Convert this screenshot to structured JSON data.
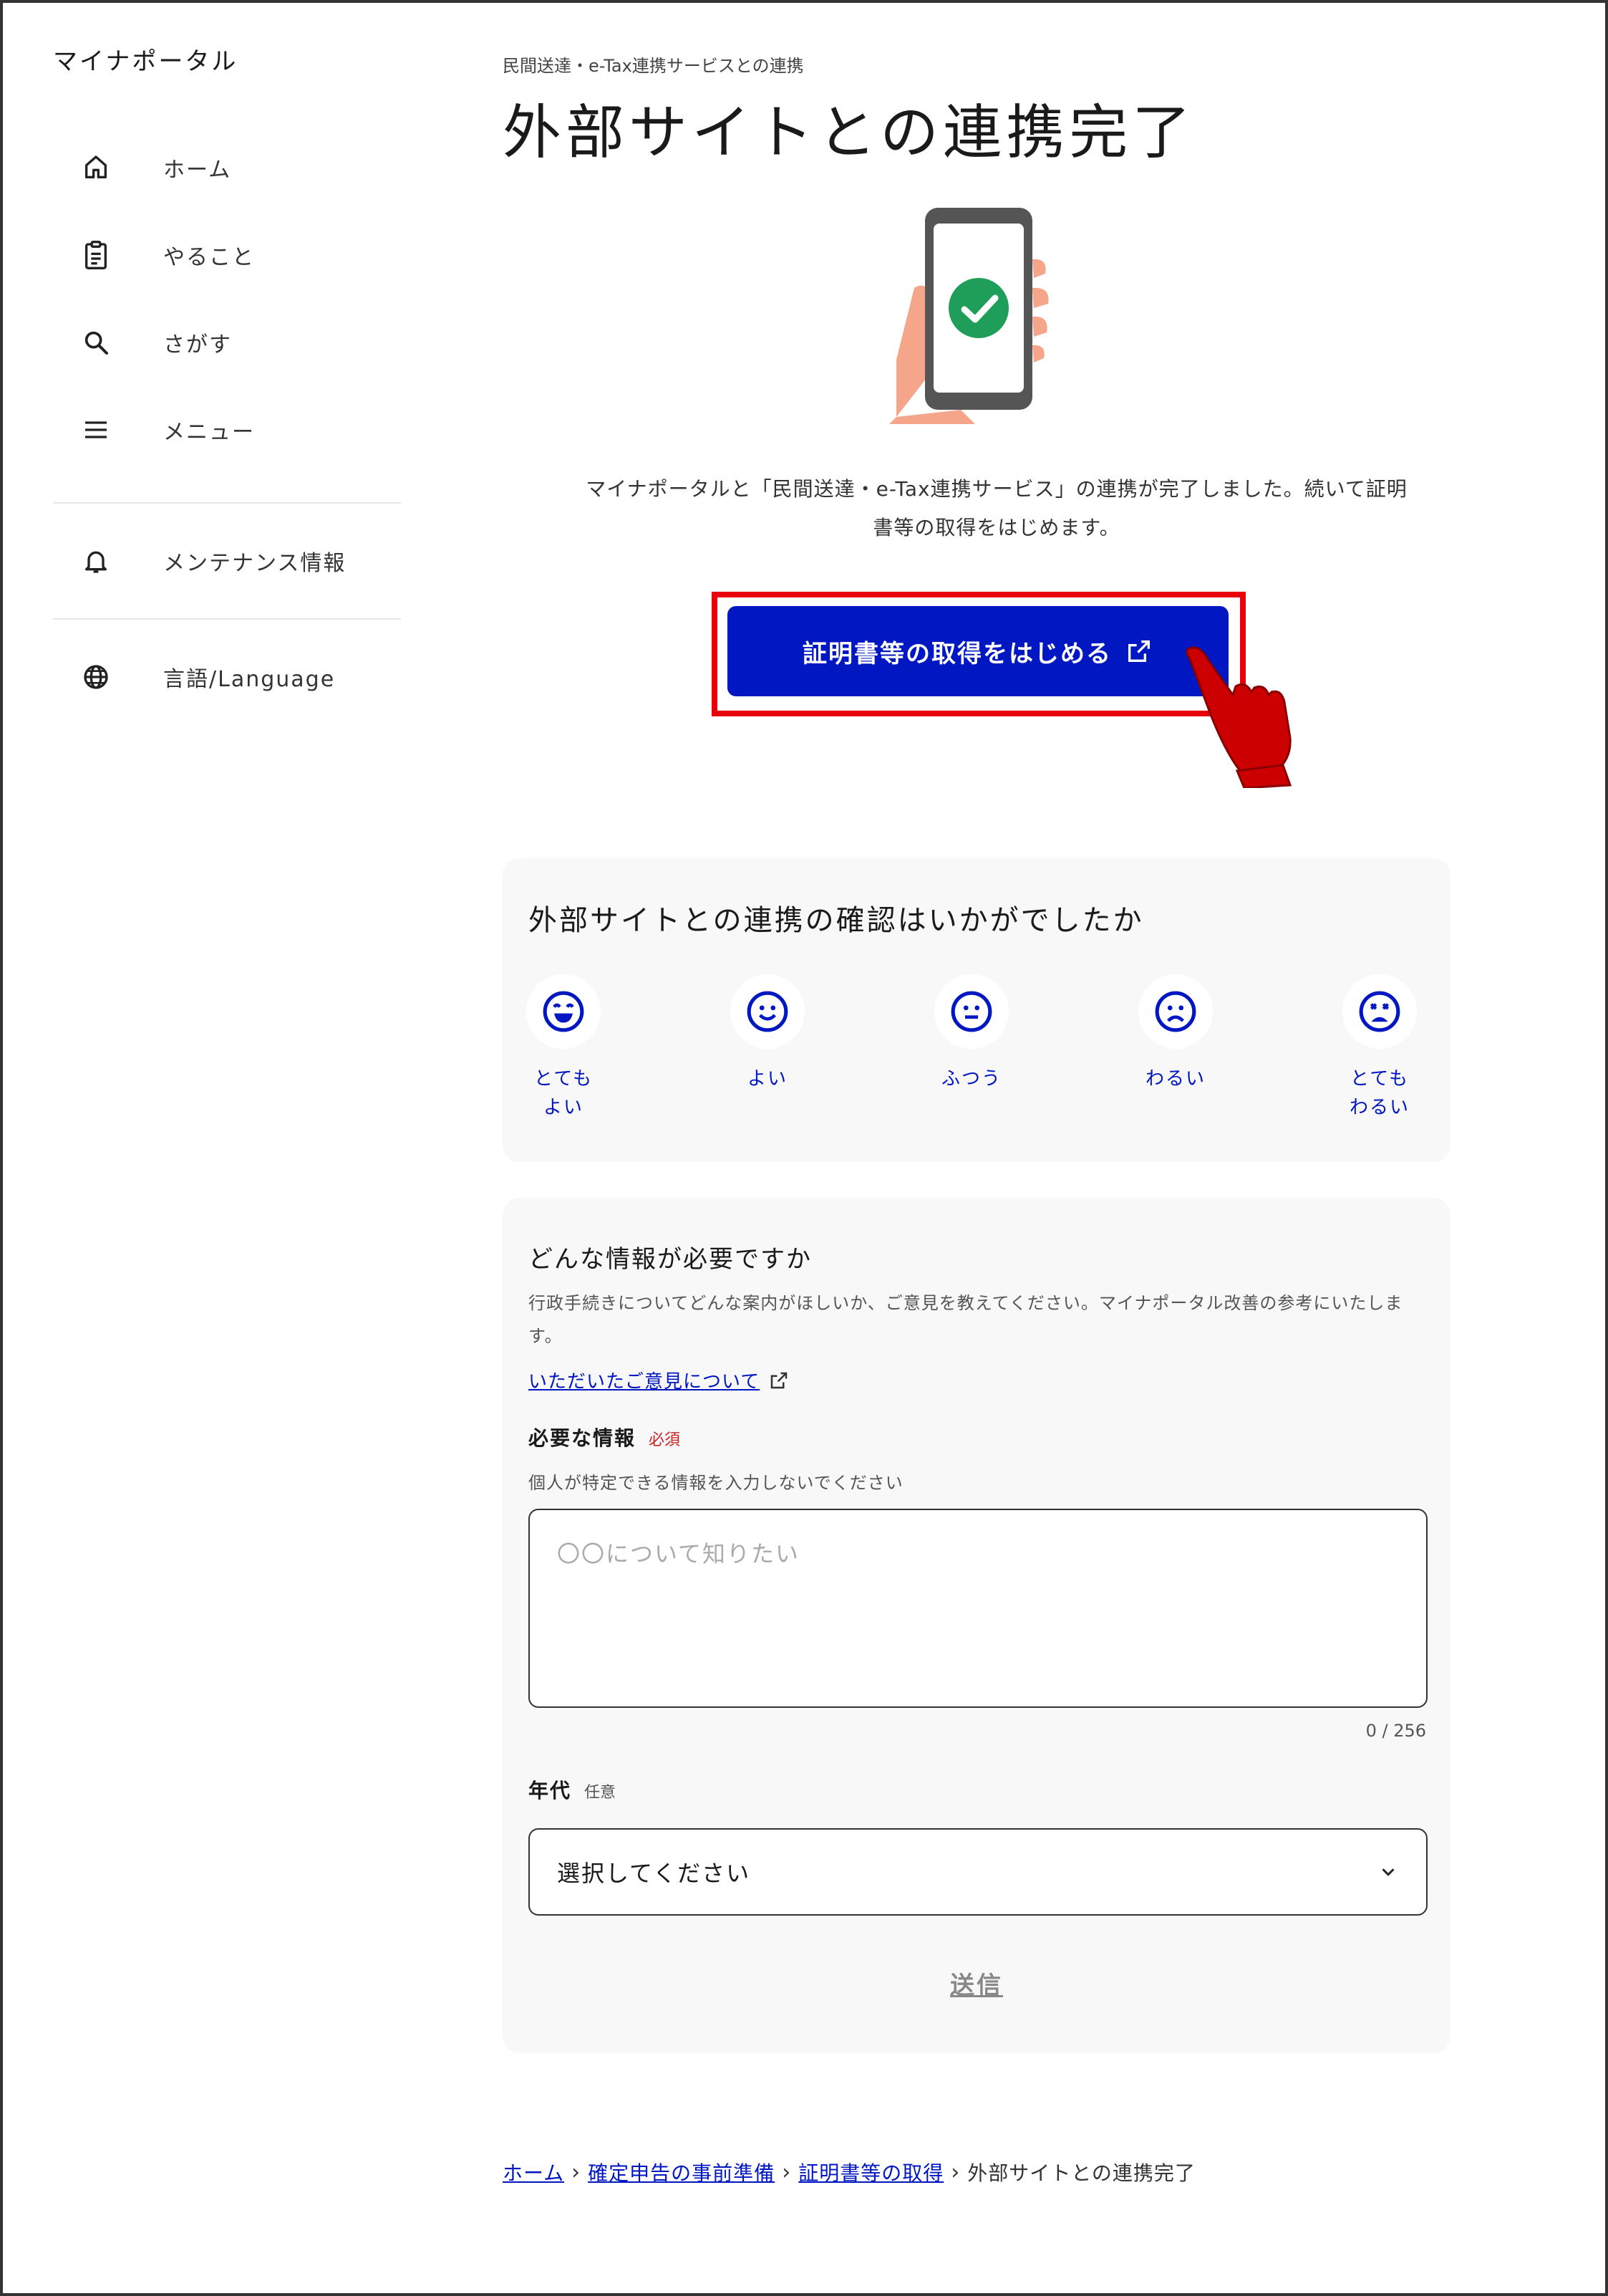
{
  "sidebar": {
    "brand": "マイナポータル",
    "items": [
      {
        "label": "ホーム",
        "icon": "home-icon"
      },
      {
        "label": "やること",
        "icon": "clipboard-icon"
      },
      {
        "label": "さがす",
        "icon": "search-icon"
      },
      {
        "label": "メニュー",
        "icon": "menu-icon"
      }
    ],
    "maintenance": {
      "label": "メンテナンス情報",
      "icon": "bell-icon"
    },
    "language": {
      "label": "言語/Language",
      "icon": "globe-icon"
    }
  },
  "header": {
    "breadcrumb_top": "民間送達・e-Tax連携サービスとの連携",
    "title": "外部サイトとの連携完了"
  },
  "main": {
    "message_line1": "マイナポータルと「民間送達・e-Tax連携サービス」の連携が完了しました。続いて証明",
    "message_line2": "書等の取得をはじめます。",
    "cta_label": "証明書等の取得をはじめる"
  },
  "feedback": {
    "question": "外部サイトとの連携の確認はいかがでしたか",
    "options": [
      {
        "label": "とても\nよい",
        "icon": "very-happy-face-icon"
      },
      {
        "label": "よい",
        "icon": "happy-face-icon"
      },
      {
        "label": "ふつう",
        "icon": "neutral-face-icon"
      },
      {
        "label": "わるい",
        "icon": "sad-face-icon"
      },
      {
        "label": "とても\nわるい",
        "icon": "very-sad-face-icon"
      }
    ]
  },
  "form": {
    "heading": "どんな情報が必要ですか",
    "description": "行政手続きについてどんな案内がほしいか、ご意見を教えてください。マイナポータル改善の参考にいたします。",
    "link": "いただいたご意見について",
    "needed_label": "必要な情報",
    "required_tag": "必須",
    "hint": "個人が特定できる情報を入力しないでください",
    "textarea_placeholder": "〇〇について知りたい",
    "counter": "0 / 256",
    "age_label": "年代",
    "optional_tag": "任意",
    "select_value": "選択してください",
    "submit": "送信"
  },
  "breadcrumb": {
    "items": [
      "ホーム",
      "確定申告の事前準備",
      "証明書等の取得"
    ],
    "current": "外部サイトとの連携完了"
  },
  "colors": {
    "accent": "#0017c1",
    "highlight": "#e8000b",
    "success": "#1e9e58"
  }
}
